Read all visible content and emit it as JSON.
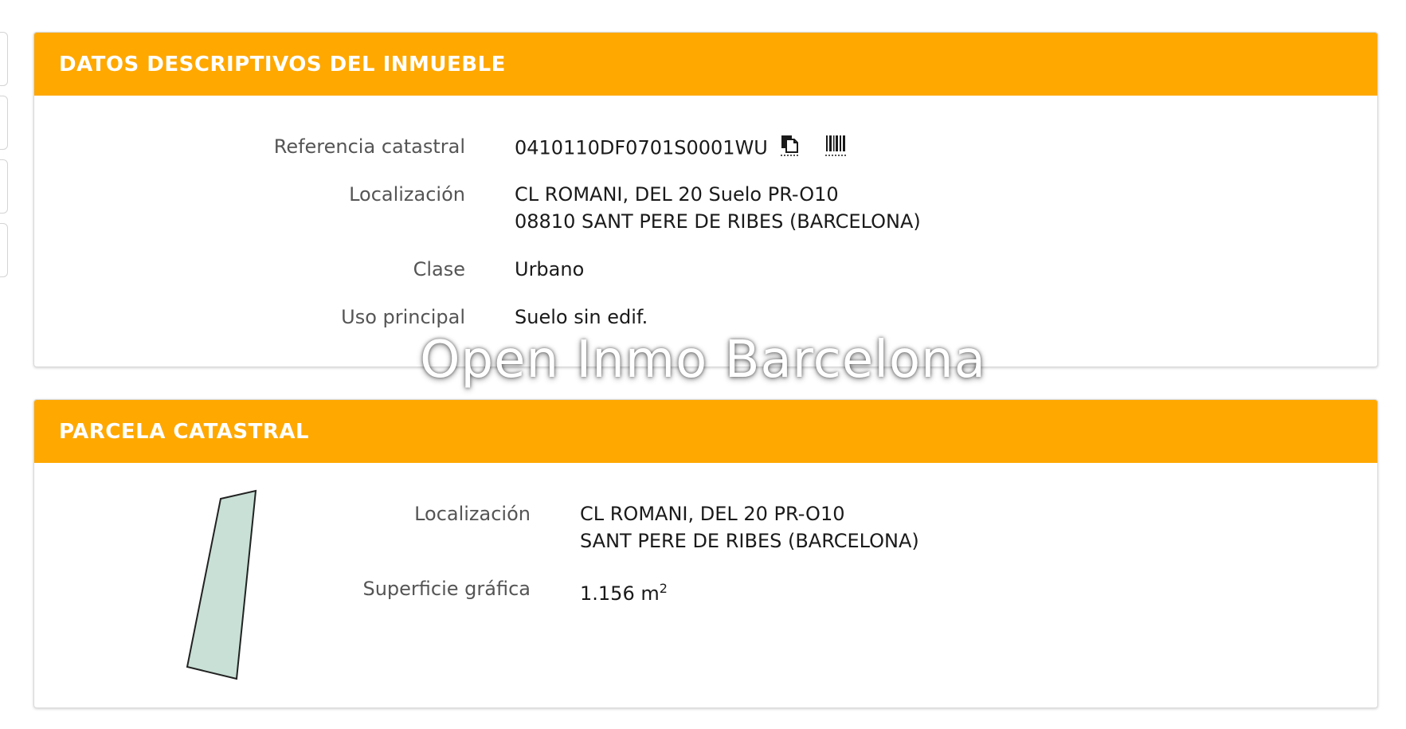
{
  "panel1": {
    "title": "DATOS DESCRIPTIVOS DEL INMUEBLE",
    "referencia_label": "Referencia catastral",
    "referencia_value": "0410110DF0701S0001WU",
    "localizacion_label": "Localización",
    "localizacion_line1": "CL ROMANI, DEL 20 Suelo PR-O10",
    "localizacion_line2": "08810 SANT PERE DE RIBES (BARCELONA)",
    "clase_label": "Clase",
    "clase_value": "Urbano",
    "uso_label": "Uso principal",
    "uso_value": "Suelo sin edif.",
    "copy_icon": "copy-document-icon",
    "barcode_icon": "barcode-icon"
  },
  "panel2": {
    "title": "PARCELA CATASTRAL",
    "localizacion_label": "Localización",
    "localizacion_line1": "CL ROMANI, DEL 20 PR-O10",
    "localizacion_line2": "SANT PERE DE RIBES (BARCELONA)",
    "superficie_label": "Superficie gráfica",
    "superficie_value": "1.156 m",
    "superficie_unit_sup": "2",
    "parcel_fill": "#c8e0d6",
    "parcel_stroke": "#222222"
  },
  "watermark": "Open Inmo Barcelona",
  "colors": {
    "header": "#ffa800",
    "header_text": "#ffffff"
  }
}
